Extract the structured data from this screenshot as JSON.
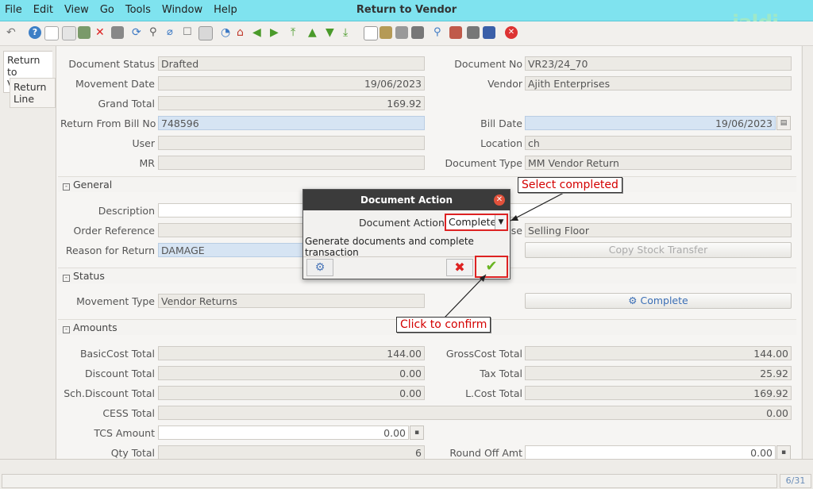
{
  "window": {
    "title": "Return to Vendor",
    "logo": "jaldi",
    "menu": [
      "File",
      "Edit",
      "View",
      "Go",
      "Tools",
      "Window",
      "Help"
    ]
  },
  "tabs": {
    "main": "Return to Vendor",
    "line": "Return Line"
  },
  "header": {
    "document_status_label": "Document Status",
    "document_status": "Drafted",
    "document_no_label": "Document No",
    "document_no": "VR23/24_70",
    "movement_date_label": "Movement Date",
    "movement_date": "19/06/2023",
    "vendor_label": "Vendor",
    "vendor": "Ajith Enterprises",
    "grand_total_label": "Grand Total",
    "grand_total": "169.92",
    "return_from_bill_label": "Return From Bill No",
    "return_from_bill": "748596",
    "bill_date_label": "Bill Date",
    "bill_date": "19/06/2023",
    "user_label": "User",
    "user": "",
    "location_label": "Location",
    "location": "ch",
    "mr_label": "MR",
    "mr": "",
    "document_type_label": "Document Type",
    "document_type": "MM Vendor Return"
  },
  "general": {
    "section_label": "General",
    "description_label": "Description",
    "description": "",
    "order_reference_label": "Order Reference",
    "order_reference": "",
    "warehouse_label_tail": "se",
    "warehouse": "Selling Floor",
    "reason_label": "Reason for Return",
    "reason": "DAMAGE",
    "copy_stock_transfer": "Copy Stock Transfer"
  },
  "status_section": {
    "section_label": "Status",
    "movement_type_label": "Movement Type",
    "movement_type": "Vendor Returns",
    "complete_button": "Complete"
  },
  "amounts": {
    "section_label": "Amounts",
    "basic_cost_label": "BasicCost Total",
    "basic_cost": "144.00",
    "gross_cost_label": "GrossCost Total",
    "gross_cost": "144.00",
    "discount_label": "Discount Total",
    "discount": "0.00",
    "tax_label": "Tax Total",
    "tax": "25.92",
    "sch_discount_label": "Sch.Discount Total",
    "sch_discount": "0.00",
    "lcost_label": "L.Cost Total",
    "lcost": "169.92",
    "cess_label": "CESS Total",
    "cess": "0.00",
    "tcs_label": "TCS Amount",
    "tcs": "0.00",
    "qty_label": "Qty Total",
    "qty": "6",
    "round_off_label": "Round Off Amt",
    "round_off": "0.00"
  },
  "dialog": {
    "title": "Document Action",
    "action_label": "Document Action",
    "action_value": "Complete",
    "description": "Generate documents and complete transaction"
  },
  "annotations": {
    "select": "Select completed",
    "confirm": "Click to confirm"
  },
  "status_bar": {
    "page": "6/31"
  }
}
